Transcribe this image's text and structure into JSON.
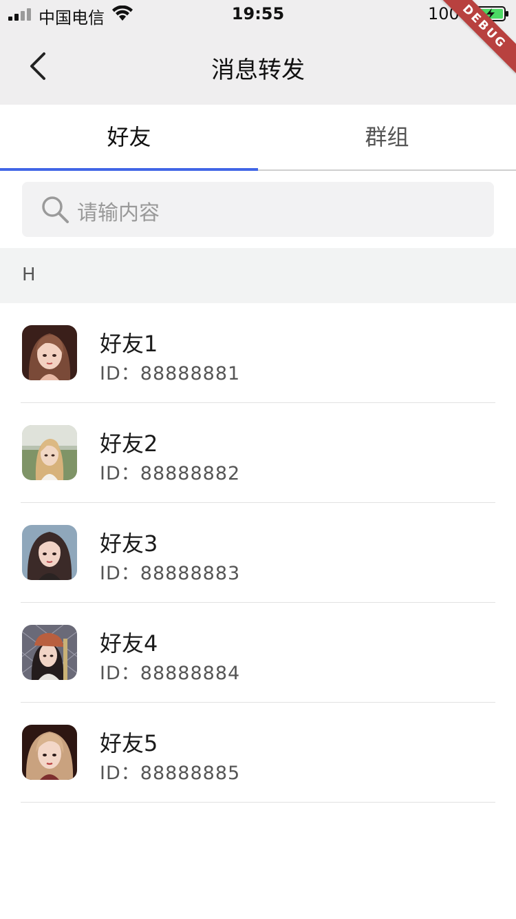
{
  "status_bar": {
    "carrier": "中国电信",
    "time": "19:55",
    "battery_percent": "100%",
    "debug_label": "DEBUG"
  },
  "header": {
    "title": "消息转发",
    "back_icon": "chevron-left-icon"
  },
  "tabs": [
    {
      "label": "好友",
      "active": true
    },
    {
      "label": "群组",
      "active": false
    }
  ],
  "search": {
    "placeholder": "请输内容",
    "icon": "search-icon"
  },
  "section": {
    "letter": "H"
  },
  "friends": [
    {
      "name": "好友1",
      "id_prefix": "ID：",
      "id": "88888881"
    },
    {
      "name": "好友2",
      "id_prefix": "ID：",
      "id": "88888882"
    },
    {
      "name": "好友3",
      "id_prefix": "ID：",
      "id": "88888883"
    },
    {
      "name": "好友4",
      "id_prefix": "ID：",
      "id": "88888884"
    },
    {
      "name": "好友5",
      "id_prefix": "ID：",
      "id": "88888885"
    }
  ],
  "colors": {
    "accent": "#4166e6",
    "header_bg": "#efeeef",
    "debug_ribbon": "#b8413f"
  }
}
